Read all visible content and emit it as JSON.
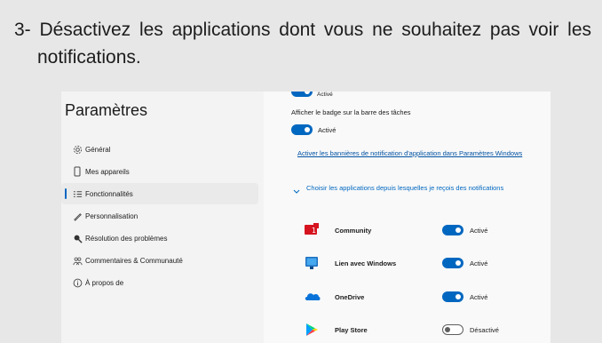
{
  "instruction": "3- Désactivez les applications dont vous ne souhaitez pas voir les notifications.",
  "window": {
    "title": "Paramètres",
    "nav": [
      {
        "label": "Général",
        "icon": "gear-icon"
      },
      {
        "label": "Mes appareils",
        "icon": "phone-icon"
      },
      {
        "label": "Fonctionnalités",
        "icon": "list-icon",
        "active": true
      },
      {
        "label": "Personnalisation",
        "icon": "pen-icon"
      },
      {
        "label": "Résolution des problèmes",
        "icon": "wrench-icon"
      },
      {
        "label": "Commentaires & Communauté",
        "icon": "community-icon"
      },
      {
        "label": "À propos de",
        "icon": "info-icon"
      }
    ]
  },
  "content": {
    "top_toggle_state": "Activé",
    "badge_label": "Afficher le badge sur la barre des tâches",
    "badge_state": "Activé",
    "banner_link": "Activer les bannières de notification d'application dans Paramètres Windows",
    "choose_apps_label": "Choisir les applications depuis lesquelles je reçois des notifications",
    "apps": [
      {
        "name": "Community",
        "state": "Activé",
        "on": true,
        "icon": "community-app-icon"
      },
      {
        "name": "Lien avec Windows",
        "state": "Activé",
        "on": true,
        "icon": "link-to-windows-icon"
      },
      {
        "name": "OneDrive",
        "state": "Activé",
        "on": true,
        "icon": "onedrive-icon"
      },
      {
        "name": "Play Store",
        "state": "Désactivé",
        "on": false,
        "icon": "play-store-icon"
      }
    ]
  },
  "colors": {
    "accent": "#0067c0",
    "background": "#e7e7e7"
  }
}
